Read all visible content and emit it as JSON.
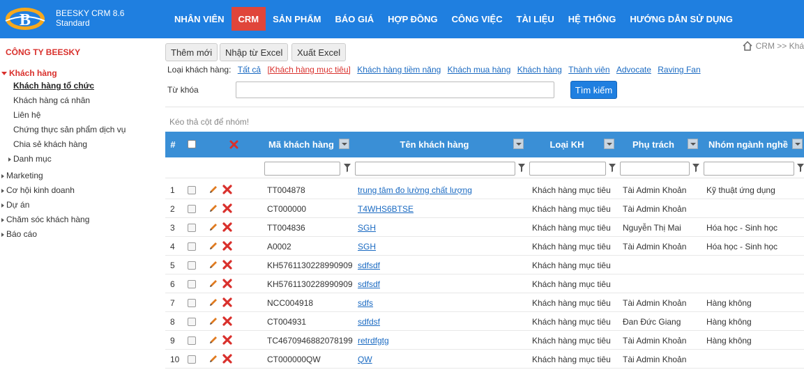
{
  "app": {
    "name": "BEESKY CRM 8.6",
    "edition": "Standard"
  },
  "nav": [
    {
      "label": "NHÂN VIÊN",
      "active": false
    },
    {
      "label": "CRM",
      "active": true
    },
    {
      "label": "SẢN PHẨM",
      "active": false
    },
    {
      "label": "BÁO GIÁ",
      "active": false
    },
    {
      "label": "HỢP ĐỒNG",
      "active": false
    },
    {
      "label": "CÔNG VIỆC",
      "active": false
    },
    {
      "label": "TÀI LIỆU",
      "active": false
    },
    {
      "label": "HỆ THỐNG",
      "active": false
    },
    {
      "label": "HƯỚNG DẪN SỬ DỤNG",
      "active": false
    }
  ],
  "company": "CÔNG TY BEESKY",
  "sidebar": {
    "items": [
      {
        "label": "Khách hàng"
      },
      {
        "label": "Khách hàng tổ chức"
      },
      {
        "label": "Khách hàng cá nhân"
      },
      {
        "label": "Liên hệ"
      },
      {
        "label": "Chứng thực sản phẩm dịch vụ"
      },
      {
        "label": "Chia sẻ khách hàng"
      },
      {
        "label": "Danh mục"
      },
      {
        "label": "Marketing"
      },
      {
        "label": "Cơ hội kinh doanh"
      },
      {
        "label": "Dự án"
      },
      {
        "label": "Chăm sóc khách hàng"
      },
      {
        "label": "Báo cáo"
      }
    ]
  },
  "toolbar": {
    "add": "Thêm mới",
    "import": "Nhập từ Excel",
    "export": "Xuất Excel"
  },
  "breadcrumb": "CRM >> Khá",
  "filter": {
    "label": "Loại khách hàng:",
    "options": [
      "Tất cả",
      "[Khách hàng mục tiêu]",
      "Khách hàng tiềm năng",
      "Khách mua hàng",
      "Khách hàng",
      "Thành viên",
      "Advocate",
      "Raving Fan"
    ]
  },
  "keyword": {
    "label": "Từ khóa",
    "value": "",
    "button": "Tìm kiếm"
  },
  "group_hint": "Kéo thả cột để nhóm!",
  "grid": {
    "columns": [
      "#",
      "Mã khách hàng",
      "Tên khách hàng",
      "Loại KH",
      "Phụ trách",
      "Nhóm ngành nghề"
    ],
    "rows": [
      {
        "n": "1",
        "code": "TT004878",
        "name": "trung tâm đo lường chất lượng",
        "type": "Khách hàng mục tiêu",
        "owner": "Tài Admin Khoản",
        "group": "Kỹ thuật ứng dụng"
      },
      {
        "n": "2",
        "code": "CT000000",
        "name": "T4WHS6BTSE",
        "type": "Khách hàng mục tiêu",
        "owner": "Tài Admin Khoản",
        "group": ""
      },
      {
        "n": "3",
        "code": "TT004836",
        "name": "SGH",
        "type": "Khách hàng mục tiêu",
        "owner": "Nguyễn Thị Mai",
        "group": "Hóa học - Sinh học"
      },
      {
        "n": "4",
        "code": "A0002",
        "name": "SGH",
        "type": "Khách hàng mục tiêu",
        "owner": "Tài Admin Khoản",
        "group": "Hóa học - Sinh học"
      },
      {
        "n": "5",
        "code": "KH5761130228990909",
        "name": "sdfsdf",
        "type": "Khách hàng mục tiêu",
        "owner": "",
        "group": ""
      },
      {
        "n": "6",
        "code": "KH5761130228990909",
        "name": "sdfsdf",
        "type": "Khách hàng mục tiêu",
        "owner": "",
        "group": ""
      },
      {
        "n": "7",
        "code": "NCC004918",
        "name": "sdfs",
        "type": "Khách hàng mục tiêu",
        "owner": "Tài Admin Khoản",
        "group": "Hàng không"
      },
      {
        "n": "8",
        "code": "CT004931",
        "name": "sdfdsf",
        "type": "Khách hàng mục tiêu",
        "owner": "Đan Đức Giang",
        "group": "Hàng không"
      },
      {
        "n": "9",
        "code": "TC4670946882078199",
        "name": "retrdfgtg",
        "type": "Khách hàng mục tiêu",
        "owner": "Tài Admin Khoản",
        "group": "Hàng không"
      },
      {
        "n": "10",
        "code": "CT000000QW",
        "name": "QW",
        "type": "Khách hàng mục tiêu",
        "owner": "Tài Admin Khoản",
        "group": ""
      }
    ]
  },
  "colors": {
    "nav_bg": "#1f7fe0",
    "nav_active": "#e0453a",
    "grid_header": "#3a8fd6",
    "accent_red": "#d9302c",
    "link": "#1a6ac2"
  }
}
